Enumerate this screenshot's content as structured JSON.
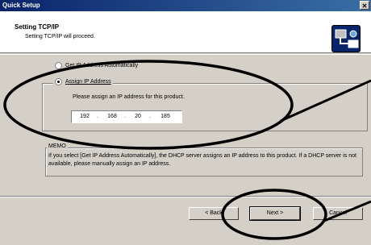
{
  "window": {
    "title": "Quick Setup",
    "close_glyph": "✕"
  },
  "header": {
    "title": "Setting TCP/IP",
    "subtitle": "Setting TCP/IP will proceed.",
    "icon": "network-setup-icon"
  },
  "options": {
    "auto": {
      "label": "Get IP Address Automatically",
      "selected": false
    },
    "assign": {
      "label": "Assign IP Address",
      "selected": true
    }
  },
  "assign_group": {
    "instruction": "Please assign an IP address for this product.",
    "ip": [
      "192",
      "168",
      "20",
      "185"
    ]
  },
  "memo": {
    "label": "MEMO",
    "text": "If you select [Get IP Address Automatically], the DHCP server assigns an IP address to this product. If a DHCP server is not available, please manually assign an IP address."
  },
  "buttons": {
    "back": "< Back",
    "next": "Next >",
    "cancel": "Cancel"
  }
}
